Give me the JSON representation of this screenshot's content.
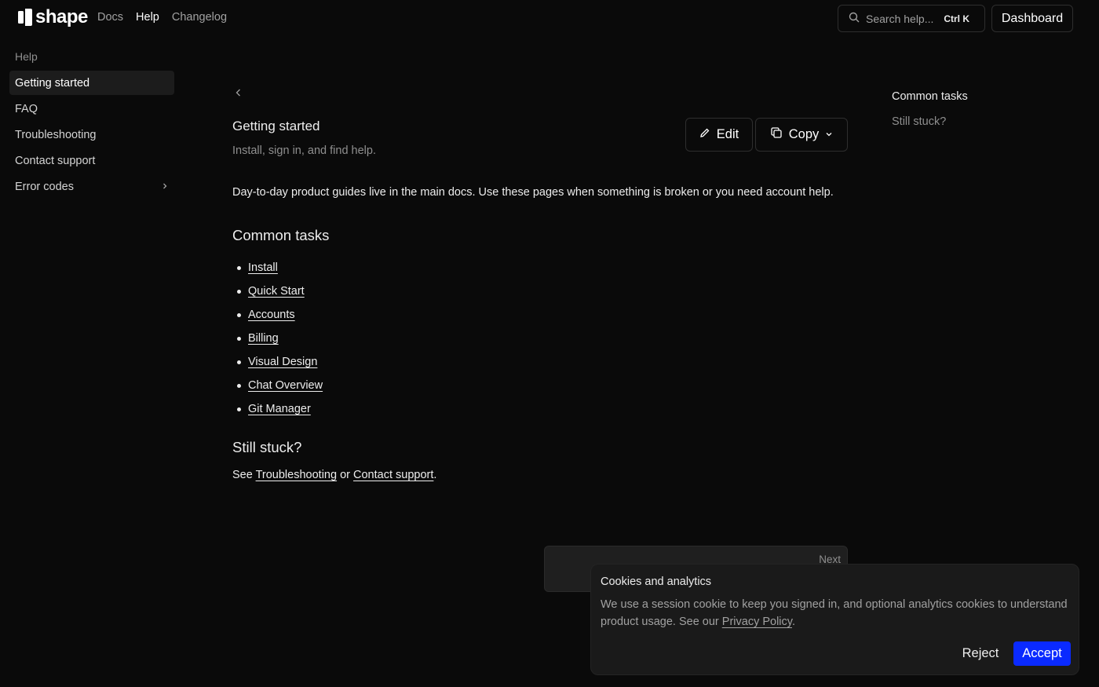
{
  "header": {
    "logo_text": "shape",
    "nav": [
      {
        "label": "Docs"
      },
      {
        "label": "Help"
      },
      {
        "label": "Changelog"
      }
    ],
    "search": {
      "placeholder": "Search help...",
      "shortcut": "Ctrl K"
    },
    "dashboard_label": "Dashboard"
  },
  "sidebar": {
    "section": "Help",
    "items": [
      {
        "label": "Getting started"
      },
      {
        "label": "FAQ"
      },
      {
        "label": "Troubleshooting"
      },
      {
        "label": "Contact support"
      },
      {
        "label": "Error codes"
      }
    ]
  },
  "main": {
    "title": "Getting started",
    "subtitle": "Install, sign in, and find help.",
    "edit_label": "Edit",
    "copy_label": "Copy",
    "intro": "Day-to-day product guides live in the main docs. Use these pages when something is broken or you need account help.",
    "common_tasks_heading": "Common tasks",
    "tasks": [
      {
        "label": "Install"
      },
      {
        "label": "Quick Start"
      },
      {
        "label": "Accounts"
      },
      {
        "label": "Billing"
      },
      {
        "label": "Visual Design"
      },
      {
        "label": "Chat Overview"
      },
      {
        "label": "Git Manager"
      }
    ],
    "still_stuck_heading": "Still stuck?",
    "see_prefix": "See",
    "see_link1": "Troubleshooting",
    "see_or": "or",
    "see_link2": "Contact support",
    "see_suffix": ".",
    "next_label": "Next"
  },
  "toc": {
    "items": [
      {
        "label": "Common tasks"
      },
      {
        "label": "Still stuck?"
      }
    ]
  },
  "cookie": {
    "title": "Cookies and analytics",
    "text": "We use a session cookie to keep you signed in, and optional analytics cookies to understand product usage. See our",
    "policy_link": "Privacy Policy",
    "text_end": ".",
    "reject_label": "Reject",
    "accept_label": "Accept"
  },
  "colors": {
    "background": "#0a0a0a",
    "accent": "#0a2aff"
  }
}
